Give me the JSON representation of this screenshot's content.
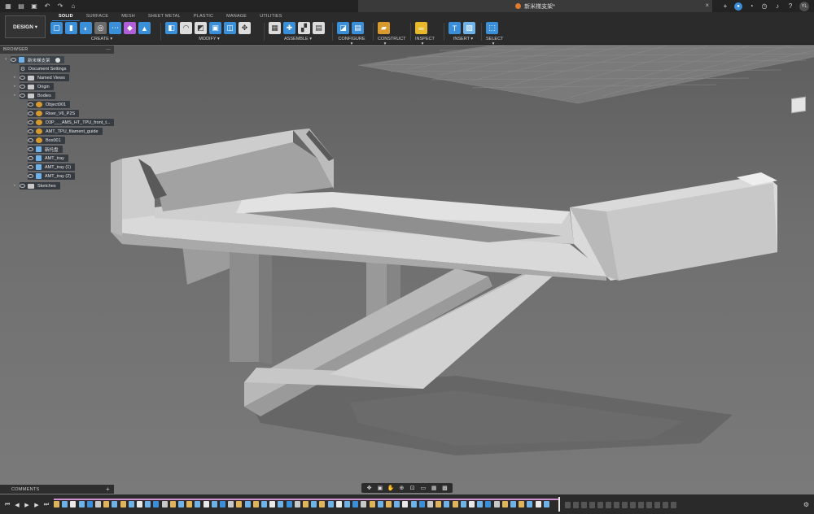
{
  "titlebar": {
    "document_title": "新米梯支架*",
    "icons": [
      "grid-icon",
      "file-icon",
      "save-icon",
      "undo-icon",
      "redo-icon",
      "home-icon"
    ],
    "right_icons": [
      "new-tab-icon",
      "extensions-icon",
      "job-status-icon",
      "notifications-icon",
      "help-icon"
    ],
    "avatar": "YL"
  },
  "toolbar": {
    "workspace": "DESIGN",
    "tabs": [
      "SOLID",
      "SURFACE",
      "MESH",
      "SHEET METAL",
      "PLASTIC",
      "MANAGE",
      "UTILITIES"
    ],
    "active_tab": "SOLID",
    "groups": [
      {
        "label": "CREATE",
        "icons": [
          "sketch",
          "extrude",
          "revolve",
          "hole",
          "pattern",
          "form",
          "mirror"
        ],
        "colors": [
          "#3a8fd8",
          "#3a8fd8",
          "#3a8fd8",
          "#6c6c6c",
          "#3a8fd8",
          "#b05fd8",
          "#3a8fd8"
        ]
      },
      {
        "label": "MODIFY",
        "icons": [
          "press-pull",
          "fillet",
          "chamfer",
          "shell",
          "combine",
          "move"
        ],
        "colors": [
          "#3a8fd8",
          "#dcdcdc",
          "#dcdcdc",
          "#3a8fd8",
          "#3a8fd8",
          "#dcdcdc"
        ]
      },
      {
        "label": "ASSEMBLE",
        "icons": [
          "new-component",
          "joint",
          "as-built-joint",
          "joint-origin"
        ],
        "colors": [
          "#dcdcdc",
          "#3a8fd8",
          "#dcdcdc",
          "#dcdcdc"
        ]
      },
      {
        "label": "CONFIGURE",
        "icons": [
          "configure",
          "table"
        ],
        "colors": [
          "#3a8fd8",
          "#3a8fd8"
        ]
      },
      {
        "label": "CONSTRUCT",
        "icons": [
          "offset-plane"
        ],
        "colors": [
          "#d89a2c"
        ]
      },
      {
        "label": "INSPECT",
        "icons": [
          "measure"
        ],
        "colors": [
          "#e6b82a"
        ]
      },
      {
        "label": "INSERT",
        "icons": [
          "insert-derive",
          "insert-image"
        ],
        "colors": [
          "#3a8fd8",
          "#6fb2e8"
        ]
      },
      {
        "label": "SELECT",
        "icons": [
          "select"
        ],
        "colors": [
          "#3a8fd8"
        ]
      }
    ]
  },
  "browser": {
    "title": "BROWSER",
    "root": "新米梯支架",
    "items": [
      {
        "label": "Document Settings",
        "kind": "settings"
      },
      {
        "label": "Named Views",
        "kind": "folder"
      },
      {
        "label": "Origin",
        "kind": "folder"
      },
      {
        "label": "Bodies",
        "kind": "folder"
      },
      {
        "label": "Object001",
        "kind": "component"
      },
      {
        "label": "Riser_V6_P2S",
        "kind": "component"
      },
      {
        "label": "D3P___AMS_HT_TPU_front_t...",
        "kind": "component"
      },
      {
        "label": "AMT_TPU_filament_guide",
        "kind": "component"
      },
      {
        "label": "Box001",
        "kind": "component"
      },
      {
        "label": "新托盘",
        "kind": "body"
      },
      {
        "label": "AMT_tray",
        "kind": "body"
      },
      {
        "label": "AMT_tray (1)",
        "kind": "body"
      },
      {
        "label": "AMT_tray (2)",
        "kind": "body"
      },
      {
        "label": "Sketches",
        "kind": "folder"
      }
    ]
  },
  "comments": {
    "label": "COMMENTS"
  },
  "navbar": {
    "icons": [
      "orbit-icon",
      "look-at-icon",
      "pan-icon",
      "zoom-icon",
      "fit-icon",
      "display-settings-icon",
      "grid-settings-icon",
      "viewports-icon"
    ]
  },
  "timeline": {
    "controls": [
      "first-icon",
      "previous-icon",
      "play-icon",
      "next-icon",
      "last-icon"
    ]
  }
}
